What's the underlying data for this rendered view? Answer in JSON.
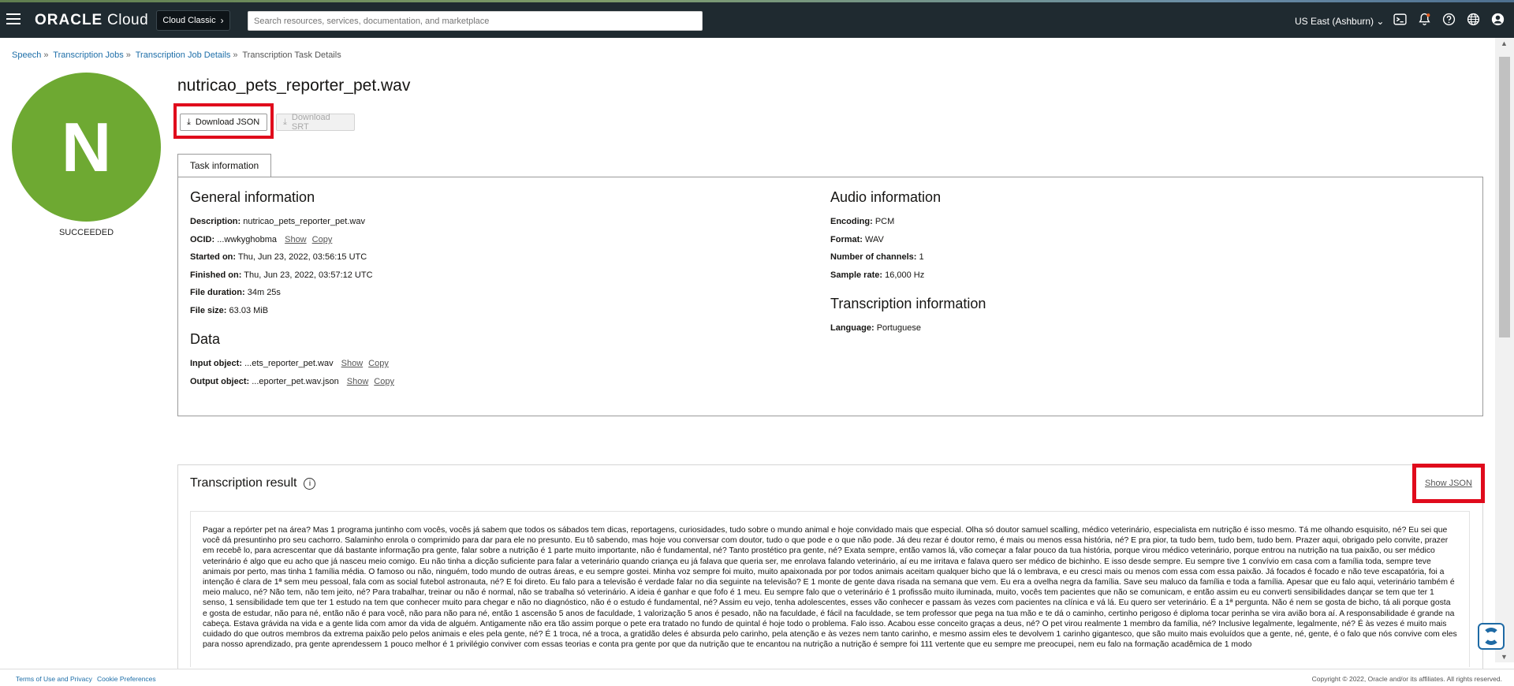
{
  "topbar": {
    "logo_brand": "ORACLE",
    "logo_product": "Cloud",
    "cloud_classic": "Cloud Classic",
    "search_placeholder": "Search resources, services, documentation, and marketplace",
    "region": "US East (Ashburn)"
  },
  "breadcrumb": {
    "items": [
      "Speech",
      "Transcription Jobs",
      "Transcription Job Details"
    ],
    "current": "Transcription Task Details"
  },
  "avatar": {
    "letter": "N",
    "color": "#6ea932",
    "status": "SUCCEEDED"
  },
  "page": {
    "title": "nutricao_pets_reporter_pet.wav",
    "download_json": "Download JSON",
    "download_srt": "Download SRT",
    "tab_task_information": "Task information"
  },
  "general": {
    "title": "General information",
    "description_label": "Description:",
    "description_value": "nutricao_pets_reporter_pet.wav",
    "ocid_label": "OCID:",
    "ocid_value": "...wwkyghobma",
    "started_label": "Started on:",
    "started_value": "Thu, Jun 23, 2022, 03:56:15 UTC",
    "finished_label": "Finished on:",
    "finished_value": "Thu, Jun 23, 2022, 03:57:12 UTC",
    "duration_label": "File duration:",
    "duration_value": "34m 25s",
    "size_label": "File size:",
    "size_value": "63.03 MiB",
    "show": "Show",
    "copy": "Copy"
  },
  "data_section": {
    "title": "Data",
    "input_label": "Input object:",
    "input_value": "...ets_reporter_pet.wav",
    "output_label": "Output object:",
    "output_value": "...eporter_pet.wav.json"
  },
  "audio": {
    "title": "Audio information",
    "encoding_label": "Encoding:",
    "encoding_value": "PCM",
    "format_label": "Format:",
    "format_value": "WAV",
    "channels_label": "Number of channels:",
    "channels_value": "1",
    "sample_label": "Sample rate:",
    "sample_value": "16,000 Hz"
  },
  "transcription_info": {
    "title": "Transcription information",
    "language_label": "Language:",
    "language_value": "Portuguese"
  },
  "result": {
    "title": "Transcription result",
    "show_json": "Show JSON",
    "text": "Pagar a repórter pet na área? Mas 1 programa juntinho com vocês, vocês já sabem que todos os sábados tem dicas, reportagens, curiosidades, tudo sobre o mundo animal e hoje convidado mais que especial. Olha só doutor samuel scalling, médico veterinário, especialista em nutrição é isso mesmo. Tá me olhando esquisito, né? Eu sei que você dá presuntinho pro seu cachorro. Salaminho enrola o comprimido para dar para ele no presunto. Eu tô sabendo, mas hoje vou conversar com doutor, tudo o que pode e o que não pode. Já deu rezar é doutor remo, é mais ou menos essa história, né? E pra pior, ta tudo bem, tudo bem, tudo bem. Prazer aqui, obrigado pelo convite, prazer em recebê lo, para acrescentar que dá bastante informação pra gente, falar sobre a nutrição é 1 parte muito importante, não é fundamental, né? Tanto prostético pra gente, né? Exata sempre, então vamos lá, vão começar a falar pouco da tua história, porque virou médico veterinário, porque entrou na nutrição na tua paixão, ou ser médico veterinário é algo que eu acho que já nasceu meio comigo. Eu não tinha a dicção suficiente para falar a veterinário quando criança eu já falava que queria ser, me enrolava falando veterinário, aí eu me irritava e falava quero ser médico de bichinho. E isso desde sempre. Eu sempre tive 1 convívio em casa com a família toda, sempre teve animais por perto, mas tinha 1 família média. O famoso ou não, ninguém, todo mundo de outras áreas, e eu sempre gostei. Minha voz sempre foi muito, muito apaixonada por por todos animais aceitam qualquer bicho que lá o lembrava, e eu cresci mais ou menos com essa com essa paixão. Já focados é focado e não teve escapatória, foi a intenção é clara de 1ª sem meu pessoal, fala com as social futebol astronauta, né? E foi direto. Eu falo para a televisão é verdade falar no dia seguinte na televisão? E 1 monte de gente dava risada na semana que vem. Eu era a ovelha negra da família. Save seu maluco da família e toda a família. Apesar que eu falo aqui, veterinário também é meio maluco, né? Não tem, não tem jeito, né? Para trabalhar, treinar ou não é normal, não se trabalha só veterinário. A ideia é ganhar e que fofo é 1 meu. Eu sempre falo que o veterinário é 1 profissão muito iluminada, muito, vocês tem pacientes que não se comunicam, e então assim eu eu converti sensibilidades dançar se tem que ter 1 senso, 1 sensibilidade tem que ter 1 estudo na tem que conhecer muito para chegar e não no diagnóstico, não é o estudo é fundamental, né? Assim eu vejo, tenha adolescentes, esses vão conhecer e passam às vezes com pacientes na clínica e vá lá. Eu quero ser veterinário. É a 1ª pergunta. Não é nem se gosta de bicho, tá ali porque gosta e gosta de estudar, não para né, então não é para você, não para não para né, então 1 ascensão 5 anos de faculdade, 1 valorização 5 anos é pesado, não na faculdade, é fácil na faculdade, se tem professor que pega na tua mão e te dá o caminho, certinho perigoso é diploma tocar perinha se vira avião bora aí. A responsabilidade é grande na cabeça. Estava grávida na vida e a gente lida com amor da vida de alguém. Antigamente não era tão assim porque o pete era tratado no fundo de quintal é hoje todo o problema. Falo isso. Acabou esse conceito graças a deus, né? O pet virou realmente 1 membro da família, né? Inclusive legalmente, legalmente, né? É às vezes é muito mais cuidado do que outros membros da extrema paixão pelo pelos animais e eles pela gente, né? É 1 troca, né a troca, a gratidão deles é absurda pelo carinho, pela atenção e às vezes nem tanto carinho, e mesmo assim eles te devolvem 1 carinho gigantesco, que são muito mais evoluídos que a gente, né, gente, é o falo que nós convive com eles para nosso aprendizado, pra gente aprendessem 1 pouco melhor é 1 privilégio conviver com essas teorias e conta pra gente por que da nutrição que te encantou na nutrição a nutrição é sempre foi 111 vertente que eu sempre me preocupei, nem eu falo na formação acadêmica de 1 modo"
  },
  "footer": {
    "terms": "Terms of Use and Privacy",
    "cookies": "Cookie Preferences",
    "copyright": "Copyright © 2022, Oracle and/or its affiliates. All rights reserved."
  }
}
